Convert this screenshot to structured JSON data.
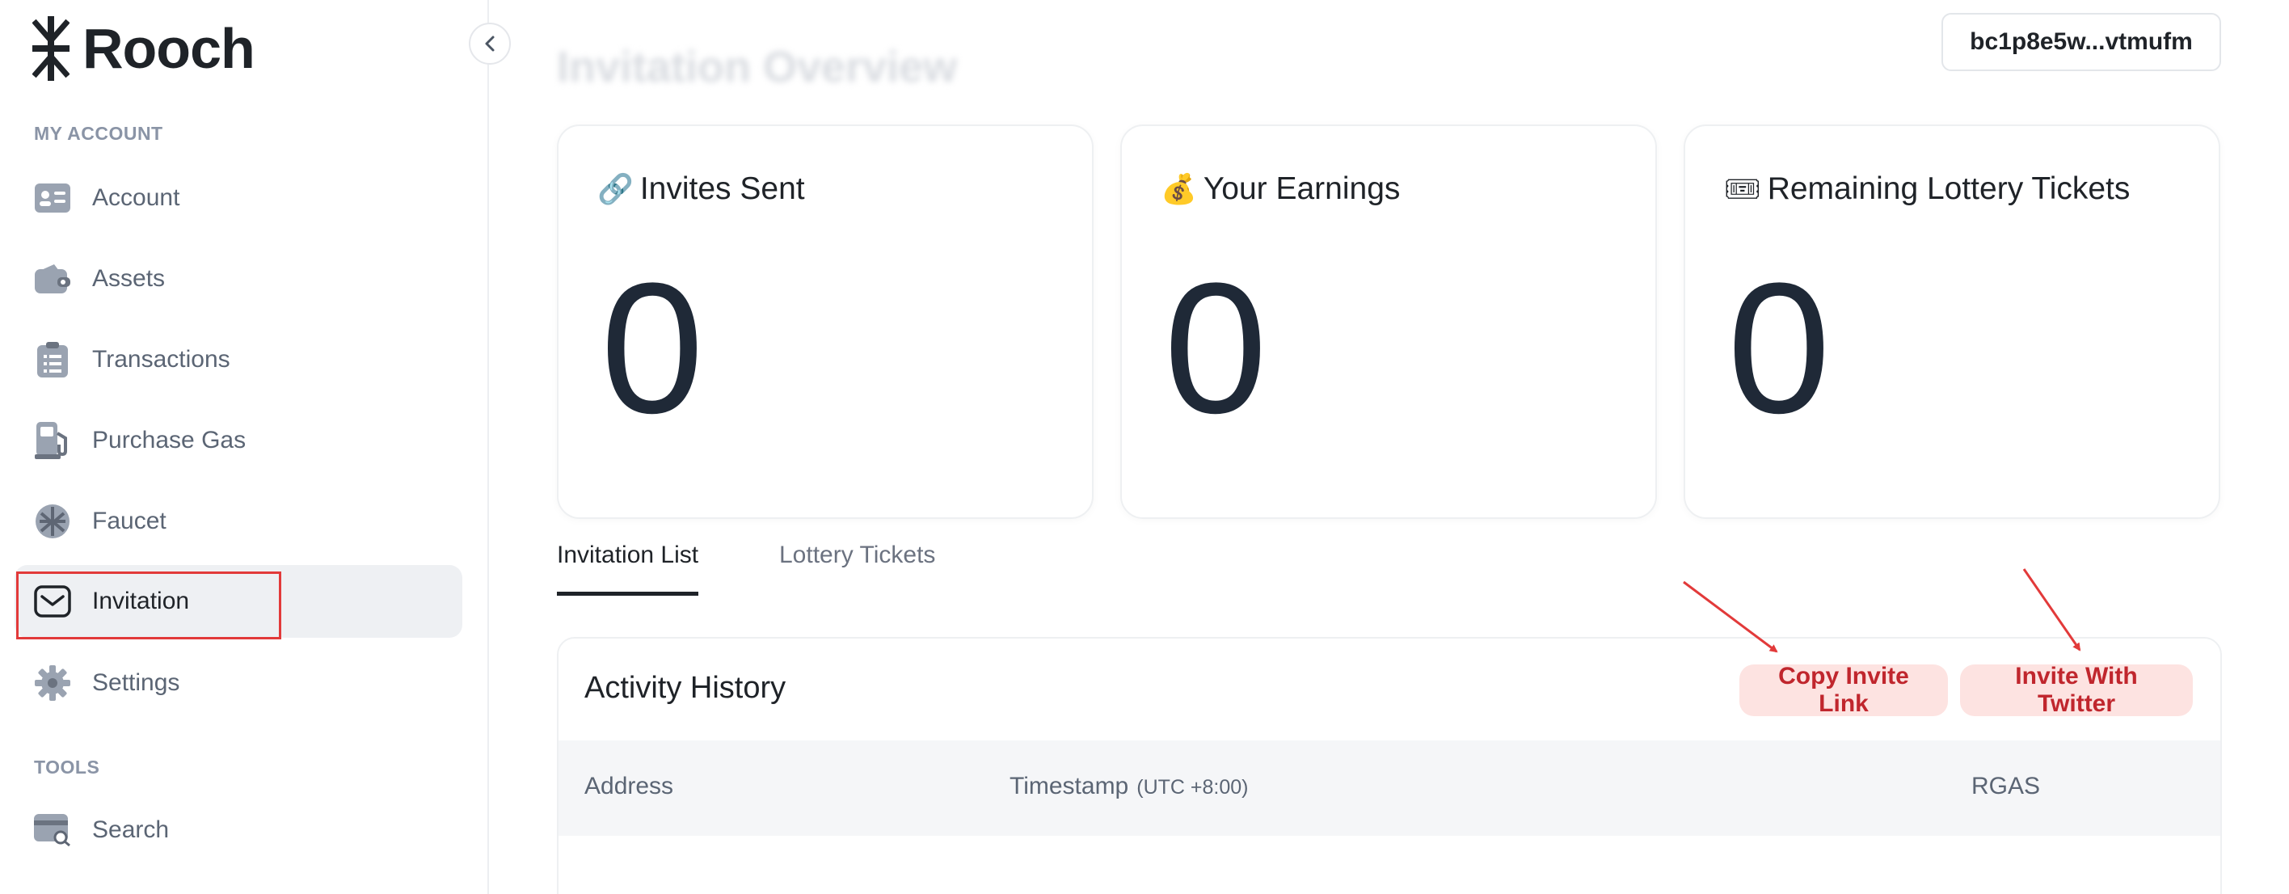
{
  "app": {
    "name": "Rooch"
  },
  "sidebar": {
    "sections": [
      {
        "label": "MY ACCOUNT"
      },
      {
        "label": "TOOLS"
      }
    ],
    "items": [
      {
        "label": "Account",
        "icon": "id-card-icon"
      },
      {
        "label": "Assets",
        "icon": "wallet-icon"
      },
      {
        "label": "Transactions",
        "icon": "clipboard-list-icon"
      },
      {
        "label": "Purchase Gas",
        "icon": "gas-pump-icon"
      },
      {
        "label": "Faucet",
        "icon": "faucet-icon"
      },
      {
        "label": "Invitation",
        "icon": "envelope-icon",
        "active": true
      },
      {
        "label": "Settings",
        "icon": "gear-icon"
      },
      {
        "label": "Search",
        "icon": "search-card-icon"
      }
    ]
  },
  "header": {
    "title": "Invitation Overview",
    "wallet_address": "bc1p8e5w...vtmufm"
  },
  "stats": [
    {
      "emoji": "🔗",
      "label": "Invites Sent",
      "value": "0"
    },
    {
      "emoji": "💰",
      "label": "Your Earnings",
      "value": "0"
    },
    {
      "emoji": "🎟",
      "label": "Remaining Lottery Tickets",
      "value": "0"
    }
  ],
  "tabs": [
    {
      "label": "Invitation List",
      "active": true
    },
    {
      "label": "Lottery Tickets",
      "active": false
    }
  ],
  "activity": {
    "title": "Activity History",
    "copy_link_label": "Copy Invite Link",
    "twitter_label": "Invite With Twitter",
    "columns": {
      "address": "Address",
      "timestamp": "Timestamp",
      "timestamp_tz": "(UTC +8:00)",
      "amount": "RGAS"
    }
  },
  "colors": {
    "accent_red": "#c0262d",
    "pill_bg": "#fde3e1",
    "annotation": "#e23a3a"
  }
}
